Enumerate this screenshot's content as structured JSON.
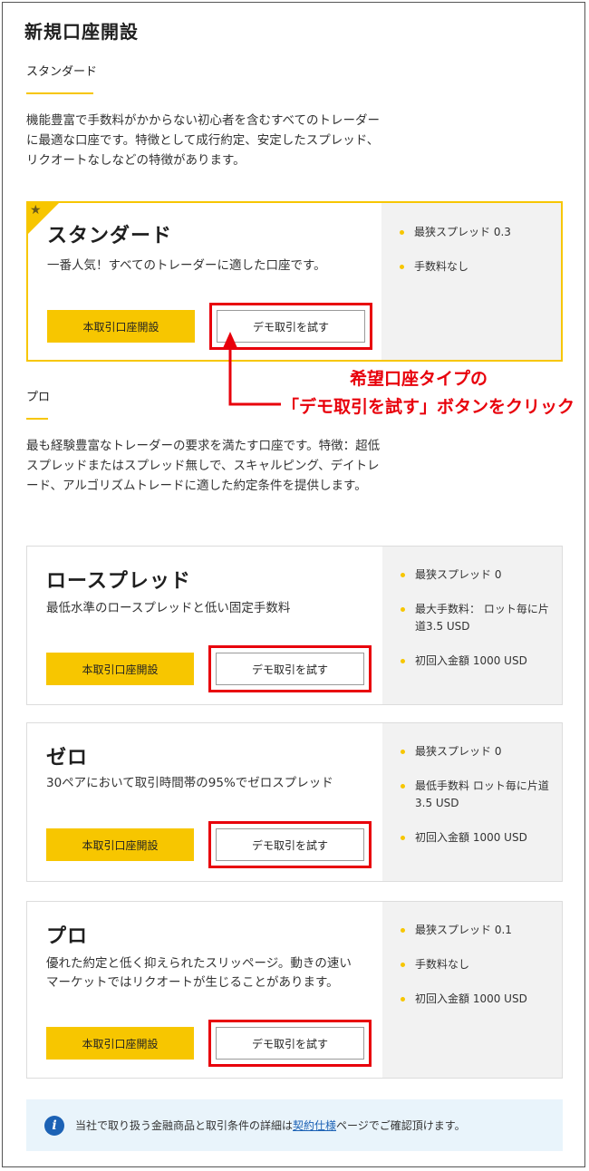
{
  "page": {
    "title": "新規口座開設"
  },
  "standard_section": {
    "title": "スタンダード",
    "description": "機能豊富で手数料がかからない初心者を含むすべてのトレーダーに最適な口座です。特徴として成行約定、安定したスプレッド、リクオートなしなどの特徴があります。"
  },
  "pro_section": {
    "title": "プロ",
    "description": "最も経験豊富なトレーダーの要求を満たす口座です。特徴：超低スプレッドまたはスプレッド無しで、スキャルピング、デイトレード、アルゴリズムトレードに適した約定条件を提供します。"
  },
  "buttons": {
    "open_real": "本取引口座開設",
    "try_demo": "デモ取引を試す"
  },
  "cards": [
    {
      "title": "スタンダード",
      "description": "一番人気！すべてのトレーダーに適した口座です。",
      "featured": true,
      "features": [
        "最狭スプレッド 0.3",
        "手数料なし"
      ]
    },
    {
      "title": "ロースプレッド",
      "description": "最低水準のロースプレッドと低い固定手数料",
      "features": [
        "最狭スプレッド 0",
        "最大手数料： ロット毎に片道3.5 USD",
        "初回入金額 1000 USD"
      ]
    },
    {
      "title": "ゼロ",
      "description": "30ペアにおいて取引時間帯の95%でゼロスプレッド",
      "features": [
        "最狭スプレッド 0",
        "最低手数料 ロット毎に片道3.5 USD",
        "初回入金額 1000 USD"
      ]
    },
    {
      "title": "プロ",
      "description": "優れた約定と低く抑えられたスリッページ。動きの速いマーケットではリクオートが生じることがあります。",
      "features": [
        "最狭スプレッド 0.1",
        "手数料なし",
        "初回入金額 1000 USD"
      ]
    }
  ],
  "annotation": {
    "line1": "希望口座タイプの",
    "line2": "「デモ取引を試す」ボタンをクリック"
  },
  "info": {
    "prefix": "当社で取り扱う金融商品と取引条件の詳細は",
    "link": "契約仕様",
    "suffix": "ページでご確認頂けます。"
  },
  "icons": {
    "star": "star-icon",
    "info": "info-icon"
  },
  "colors": {
    "accent": "#f7c600",
    "highlight": "#e8000b",
    "link": "#1c62b5",
    "info_bg": "#e9f4fb"
  }
}
